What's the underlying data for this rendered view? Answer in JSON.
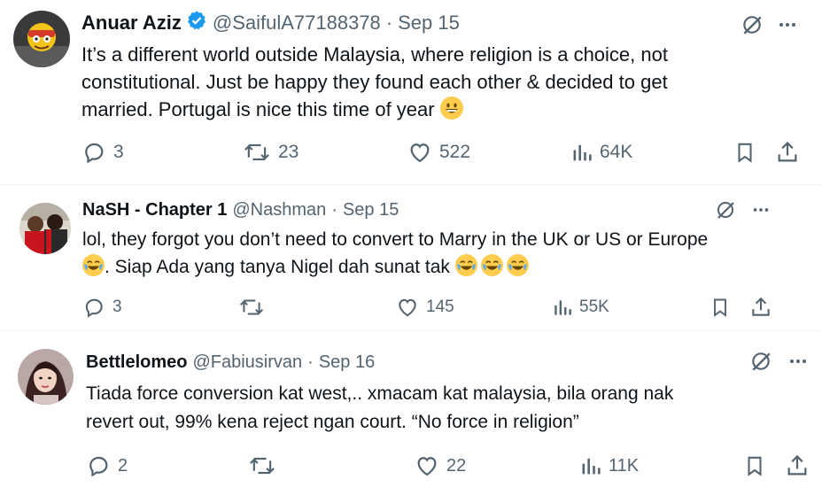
{
  "tweets": [
    {
      "name": "Anuar Aziz",
      "verified": true,
      "handle": "@SaifulA77188378",
      "separator": "·",
      "date": "Sep 15",
      "lines": [
        "It’s a different world outside Malaysia, where religion is a choice, not",
        "constitutional. Just be happy they found each other & decided to get",
        "married. Portugal is nice this time of year"
      ],
      "emoji_icons": [
        "grinning-face-emoji"
      ],
      "replies": "3",
      "reposts": "23",
      "likes": "522",
      "views": "64K"
    },
    {
      "name": "NaSH - Chapter 1",
      "verified": false,
      "handle": "@Nashman",
      "separator": "·",
      "date": "Sep 15",
      "lines": [
        "lol, they forgot you don’t need to convert to Marry in the UK or US or Europe",
        ". Siap Ada yang tanya Nigel dah sunat tak"
      ],
      "emoji_icons": [
        "tears-of-joy-emoji",
        "tears-of-joy-emoji",
        "tears-of-joy-emoji",
        "tears-of-joy-emoji"
      ],
      "replies": "3",
      "reposts": "",
      "likes": "145",
      "views": "55K"
    },
    {
      "name": "Bettlelomeo",
      "verified": false,
      "handle": "@Fabiusirvan",
      "separator": "·",
      "date": "Sep 16",
      "lines": [
        "Tiada force conversion kat west,.. xmacam kat malaysia, bila orang nak",
        "revert out, 99% kena reject ngan court. “No force in religion”"
      ],
      "emoji_icons": [],
      "replies": "2",
      "reposts": "",
      "likes": "22",
      "views": "11K"
    }
  ],
  "colors": {
    "text": "#0f1419",
    "secondary": "#536471",
    "verified": "#1d9bf0",
    "divider": "#eff3f4",
    "emoji": "#ffcc4d"
  },
  "icons": [
    "reply-icon",
    "repost-icon",
    "like-icon",
    "views-icon",
    "bookmark-icon",
    "share-icon",
    "grok-icon",
    "more-icon",
    "verified-badge-icon"
  ]
}
